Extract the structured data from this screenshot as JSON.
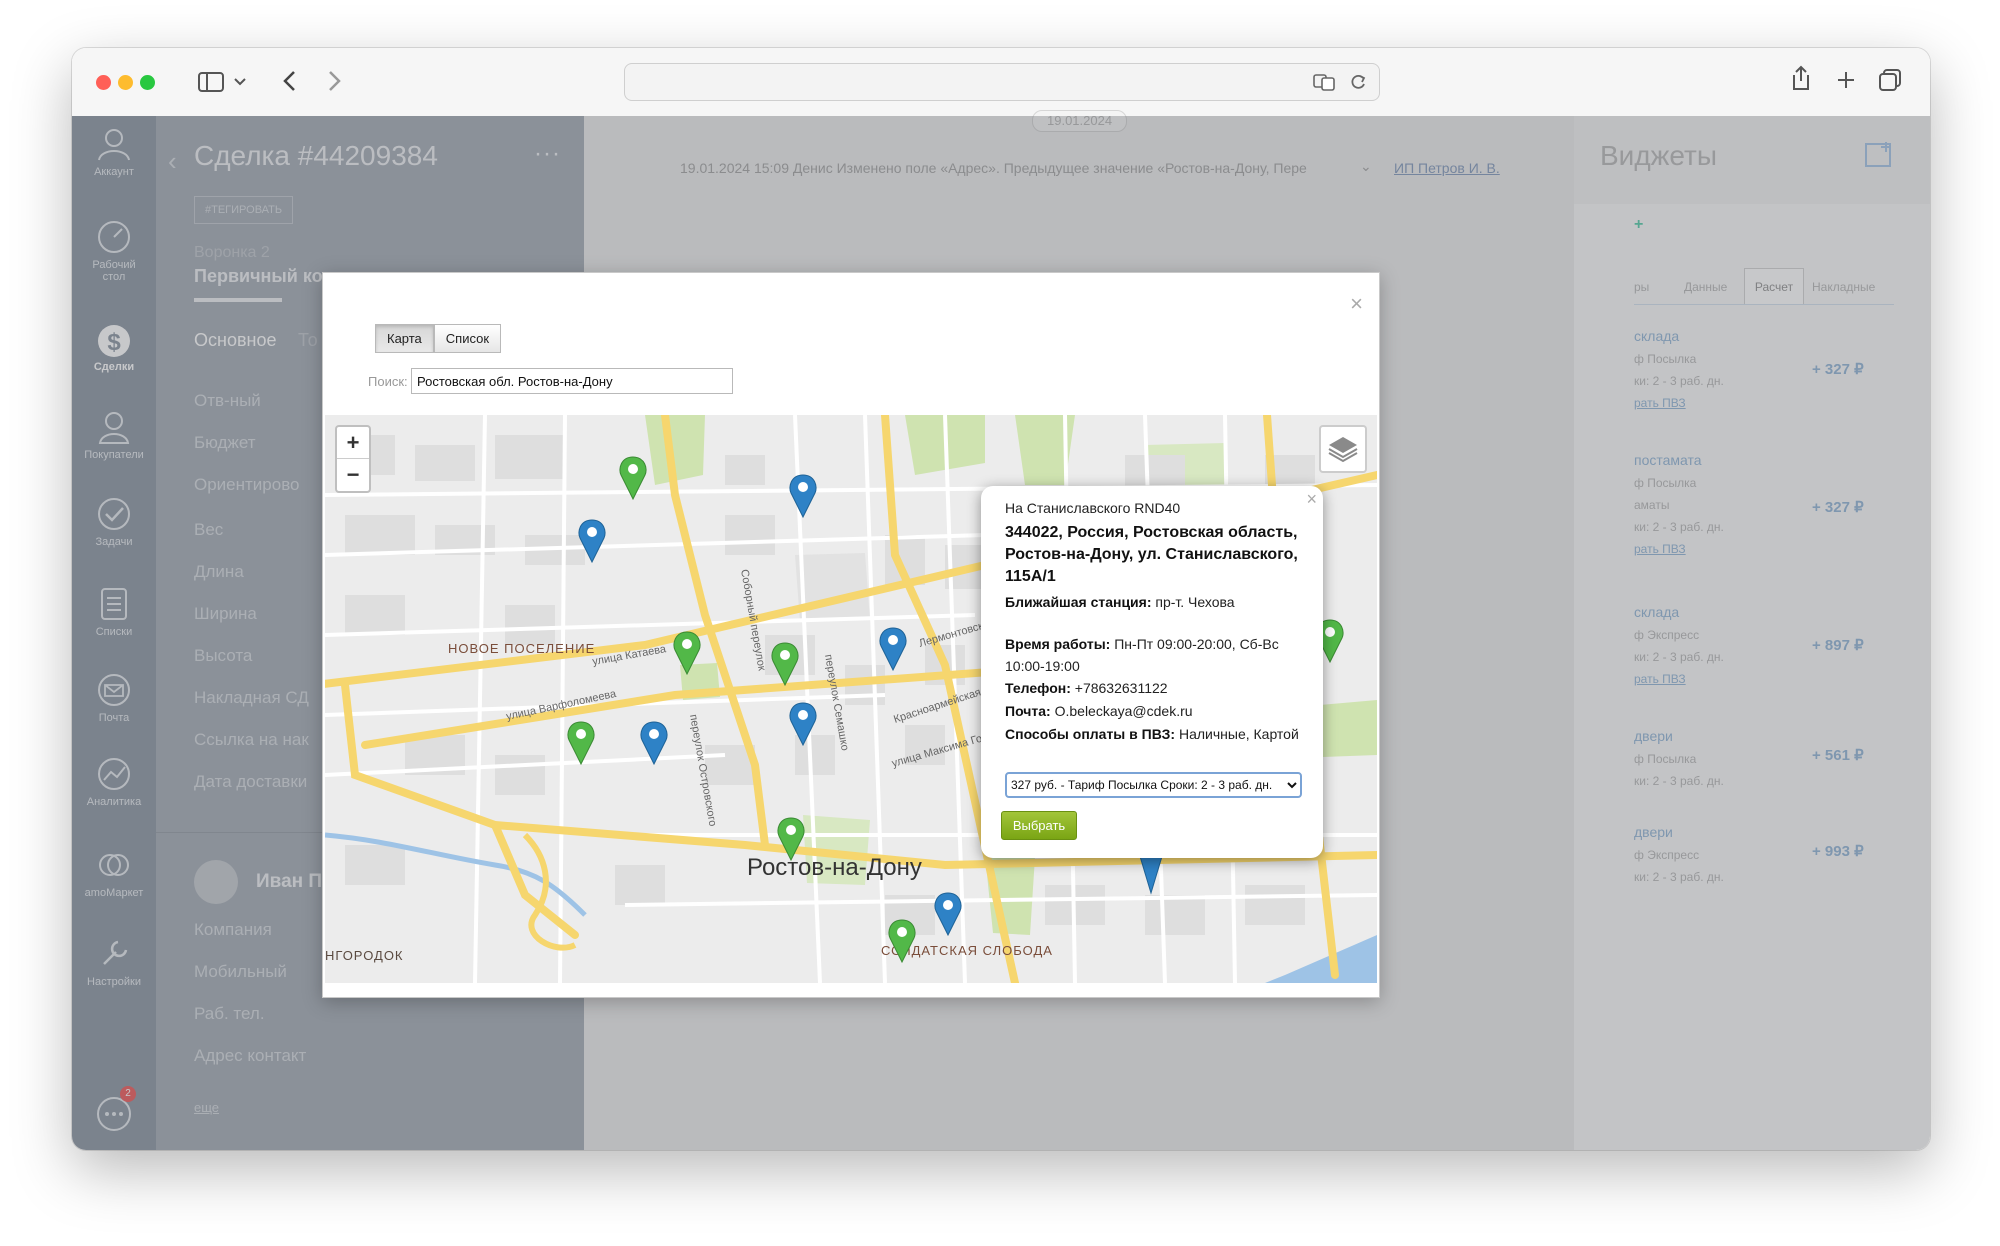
{
  "app": {
    "rail": [
      {
        "label": "Аккаунт"
      },
      {
        "label": "Рабочий стол"
      },
      {
        "label": "Сделки"
      },
      {
        "label": "Покупатели"
      },
      {
        "label": "Задачи"
      },
      {
        "label": "Списки"
      },
      {
        "label": "Почта"
      },
      {
        "label": "Аналитика"
      },
      {
        "label": "amoМаркет"
      },
      {
        "label": "Настройки"
      }
    ],
    "chat_badge": "2"
  },
  "deal": {
    "title": "Сделка #44209384",
    "tag_button": "#ТЕГИРОВАТЬ",
    "funnel": "Воронка 2",
    "stage": "Первичный кон",
    "tab_main": "Основное",
    "tab_other": "То",
    "fields": [
      "Отв-ный",
      "Бюджет",
      "Ориентирово",
      "Вес",
      "Длина",
      "Ширина",
      "Высота",
      "Накладная СД",
      "Ссылка на нак",
      "Дата доставки"
    ],
    "contact_name": "Иван П",
    "contact_fields": [
      "Компания",
      "Мобильный",
      "Раб. тел.",
      "Адрес контакт"
    ],
    "more": "еще"
  },
  "feed": {
    "date_chip": "19.01.2024",
    "event": "19.01.2024 15:09 Денис Изменено поле «Адрес». Предыдущее значение «Ростов-на-Дону, Пере",
    "author": "ИП Петров И. В."
  },
  "widgets": {
    "title": "Виджеты",
    "tabs": [
      "ры",
      "Данные",
      "Расчет",
      "Накладные"
    ],
    "active_tab": "Расчет",
    "rows": [
      {
        "name": "склада",
        "line1": "ф Посылка",
        "line2": "ки: 2 - 3 раб. дн.",
        "link": "рать ПВЗ",
        "price": "+ 327 ₽"
      },
      {
        "name": "постамата",
        "line1": "ф Посылка",
        "line2": "аматы",
        "line3": "ки: 2 - 3 раб. дн.",
        "link": "рать ПВЗ",
        "price": "+ 327 ₽"
      },
      {
        "name": "склада",
        "line1": "ф Экспресс",
        "line2": "ки: 2 - 3 раб. дн.",
        "link": "рать ПВЗ",
        "price": "+ 897 ₽"
      },
      {
        "name": "двери",
        "line1": "ф Посылка",
        "line2": "ки: 2 - 3 раб. дн.",
        "price": "+ 561 ₽"
      },
      {
        "name": "двери",
        "line1": "ф Экспресс",
        "line2": "ки: 2 - 3 раб. дн.",
        "price": "+ 993 ₽"
      }
    ]
  },
  "modal": {
    "tab_map": "Карта",
    "tab_list": "Список",
    "search_label": "Поиск:",
    "search_value": "Ростовская обл. Ростов-на-Дону",
    "map": {
      "city_label": "Ростов-на-Дону",
      "district_1": "НОВОЕ ПОСЕЛЕНИЕ",
      "district_2": "СОЛДАТСКАЯ СЛОБОДА",
      "district_3": "НГОРОДОК",
      "streets": [
        "Соборный переулок",
        "переулок Семашко",
        "переулок Островского",
        "улица Катаева",
        "улица Варфоломеева",
        "Лермонтовская",
        "Красноармейская улица",
        "улица Максима Горького"
      ],
      "zoom_in": "+",
      "zoom_out": "−",
      "marker_green": "#52b848",
      "marker_blue": "#2e82c6"
    },
    "popup": {
      "name": "На Станиславского RND40",
      "address": "344022, Россия, Ростовская область, Ростов-на-Дону, ул. Станиславского, 115А/1",
      "station_label": "Ближайшая станция:",
      "station": "пр-т. Чехова",
      "hours_label": "Время работы:",
      "hours": "Пн-Пт 09:00-20:00, Сб-Вс 10:00-19:00",
      "phone_label": "Телефон:",
      "phone": "+78632631122",
      "mail_label": "Почта:",
      "mail": "O.beleckaya@cdek.ru",
      "pay_label": "Способы оплаты в ПВЗ:",
      "pay": "Наличные, Картой",
      "tariff": "327 руб. - Тариф Посылка Сроки: 2 - 3 раб. дн.",
      "choose": "Выбрать"
    }
  }
}
